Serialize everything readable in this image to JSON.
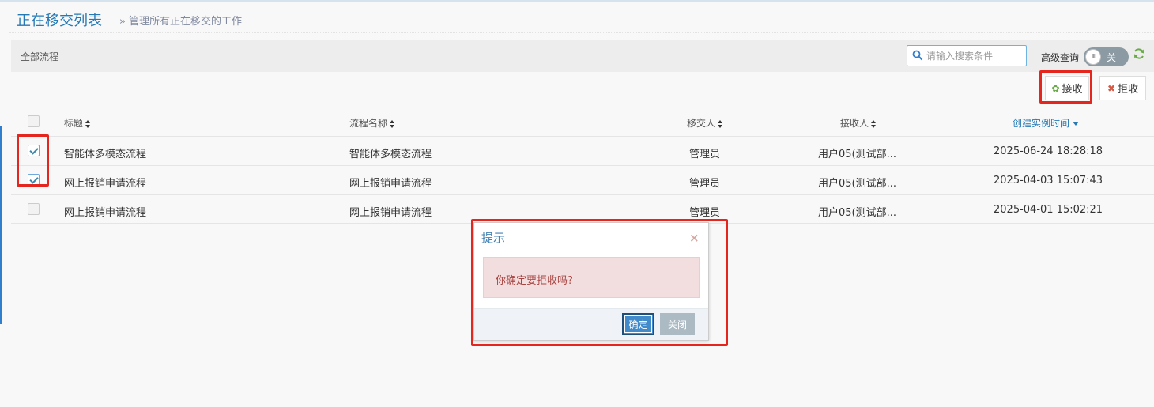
{
  "header": {
    "title": "正在移交列表",
    "subtitle_prefix": "»",
    "subtitle": "管理所有正在移交的工作"
  },
  "toolbar": {
    "title": "全部流程",
    "search_placeholder": "请输入搜索条件",
    "advanced_label": "高级查询",
    "toggle_knob": "III",
    "toggle_text": "关",
    "receive_label": "接收",
    "reject_label": "拒收"
  },
  "table": {
    "columns": {
      "title": "标题",
      "flow_name": "流程名称",
      "transferor": "移交人",
      "receiver": "接收人",
      "created": "创建实例时间"
    },
    "rows": [
      {
        "checked": true,
        "title": "智能体多模态流程",
        "flow_name": "智能体多模态流程",
        "transferor": "管理员",
        "receiver": "用户05(测试部...",
        "created": "2025-06-24 18:28:18"
      },
      {
        "checked": true,
        "title": "网上报销申请流程",
        "flow_name": "网上报销申请流程",
        "transferor": "管理员",
        "receiver": "用户05(测试部...",
        "created": "2025-04-03 15:07:43"
      },
      {
        "checked": false,
        "title": "网上报销申请流程",
        "flow_name": "网上报销申请流程",
        "transferor": "管理员",
        "receiver": "用户05(测试部...",
        "created": "2025-04-01 15:02:21"
      }
    ]
  },
  "dialog": {
    "title": "提示",
    "close_symbol": "×",
    "message": "你确定要拒收吗?",
    "confirm_label": "确定",
    "close_label": "关闭"
  },
  "colors": {
    "accent": "#2679b5",
    "highlight": "#e5261f",
    "alert_bg": "#f2dede",
    "alert_text": "#a94442"
  }
}
